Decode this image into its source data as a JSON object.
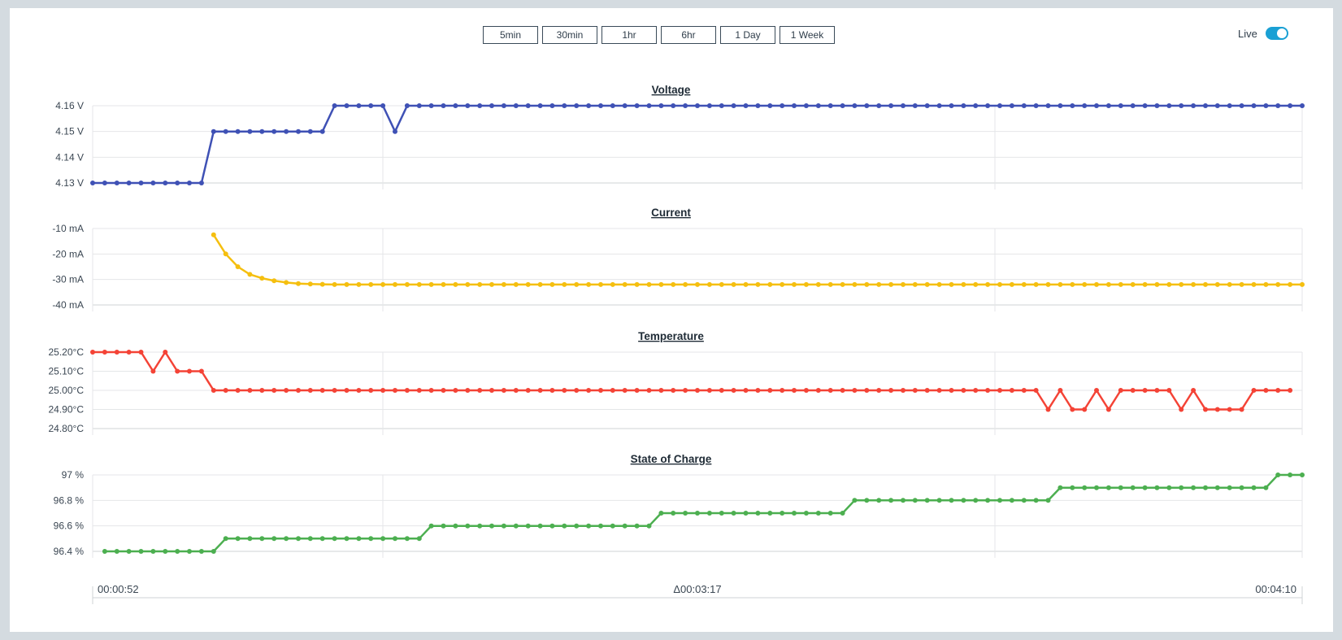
{
  "ranges": [
    "5min",
    "30min",
    "1hr",
    "6hr",
    "1 Day",
    "1 Week"
  ],
  "live": {
    "label": "Live",
    "on": true
  },
  "x_axis": {
    "start": "00:00:52",
    "delta": "Δ00:03:17",
    "end": "00:04:10"
  },
  "chart_data": [
    {
      "type": "line",
      "title": "Voltage",
      "color": "#3f51b5",
      "unit": "V",
      "yticks": [
        "4.16 V",
        "4.15 V",
        "4.14 V",
        "4.13 V"
      ],
      "ylim": [
        4.13,
        4.16
      ],
      "x_start_index": 0,
      "values": [
        4.13,
        4.13,
        4.13,
        4.13,
        4.13,
        4.13,
        4.13,
        4.13,
        4.13,
        4.13,
        4.15,
        4.15,
        4.15,
        4.15,
        4.15,
        4.15,
        4.15,
        4.15,
        4.15,
        4.15,
        4.16,
        4.16,
        4.16,
        4.16,
        4.16,
        4.15,
        4.16,
        4.16,
        4.16,
        4.16,
        4.16,
        4.16,
        4.16,
        4.16,
        4.16,
        4.16,
        4.16,
        4.16,
        4.16,
        4.16,
        4.16,
        4.16,
        4.16,
        4.16,
        4.16,
        4.16,
        4.16,
        4.16,
        4.16,
        4.16,
        4.16,
        4.16,
        4.16,
        4.16,
        4.16,
        4.16,
        4.16,
        4.16,
        4.16,
        4.16,
        4.16,
        4.16,
        4.16,
        4.16,
        4.16,
        4.16,
        4.16,
        4.16,
        4.16,
        4.16,
        4.16,
        4.16,
        4.16,
        4.16,
        4.16,
        4.16,
        4.16,
        4.16,
        4.16,
        4.16,
        4.16,
        4.16,
        4.16,
        4.16,
        4.16,
        4.16,
        4.16,
        4.16,
        4.16,
        4.16,
        4.16,
        4.16,
        4.16,
        4.16,
        4.16,
        4.16,
        4.16,
        4.16,
        4.16,
        4.16,
        4.16
      ]
    },
    {
      "type": "line",
      "title": "Current",
      "color": "#f5bf0f",
      "unit": "mA",
      "yticks": [
        "-10 mA",
        "-20 mA",
        "-30 mA",
        "-40 mA"
      ],
      "ylim": [
        -40,
        -10
      ],
      "x_start_index": 10,
      "values": [
        -12.5,
        -20,
        -25,
        -28,
        -29.5,
        -30.5,
        -31.2,
        -31.6,
        -31.8,
        -31.9,
        -32,
        -32,
        -32,
        -32,
        -32,
        -32,
        -32,
        -32,
        -32,
        -32,
        -32,
        -32,
        -32,
        -32,
        -32,
        -32,
        -32,
        -32,
        -32,
        -32,
        -32,
        -32,
        -32,
        -32,
        -32,
        -32,
        -32,
        -32,
        -32,
        -32,
        -32,
        -32,
        -32,
        -32,
        -32,
        -32,
        -32,
        -32,
        -32,
        -32,
        -32,
        -32,
        -32,
        -32,
        -32,
        -32,
        -32,
        -32,
        -32,
        -32,
        -32,
        -32,
        -32,
        -32,
        -32,
        -32,
        -32,
        -32,
        -32,
        -32,
        -32,
        -32,
        -32,
        -32,
        -32,
        -32,
        -32,
        -32,
        -32,
        -32,
        -32,
        -32,
        -32,
        -32,
        -32,
        -32,
        -32,
        -32,
        -32,
        -32,
        -32
      ]
    },
    {
      "type": "line",
      "title": "Temperature",
      "color": "#f44336",
      "unit": "°C",
      "yticks": [
        "25.20°C",
        "25.10°C",
        "25.00°C",
        "24.90°C",
        "24.80°C"
      ],
      "ylim": [
        24.8,
        25.2
      ],
      "x_start_index": 0,
      "values": [
        25.2,
        25.2,
        25.2,
        25.2,
        25.2,
        25.1,
        25.2,
        25.1,
        25.1,
        25.1,
        25.0,
        25.0,
        25.0,
        25.0,
        25.0,
        25.0,
        25.0,
        25.0,
        25.0,
        25.0,
        25.0,
        25.0,
        25.0,
        25.0,
        25.0,
        25.0,
        25.0,
        25.0,
        25.0,
        25.0,
        25.0,
        25.0,
        25.0,
        25.0,
        25.0,
        25.0,
        25.0,
        25.0,
        25.0,
        25.0,
        25.0,
        25.0,
        25.0,
        25.0,
        25.0,
        25.0,
        25.0,
        25.0,
        25.0,
        25.0,
        25.0,
        25.0,
        25.0,
        25.0,
        25.0,
        25.0,
        25.0,
        25.0,
        25.0,
        25.0,
        25.0,
        25.0,
        25.0,
        25.0,
        25.0,
        25.0,
        25.0,
        25.0,
        25.0,
        25.0,
        25.0,
        25.0,
        25.0,
        25.0,
        25.0,
        25.0,
        25.0,
        25.0,
        25.0,
        24.9,
        25.0,
        24.9,
        24.9,
        25.0,
        24.9,
        25.0,
        25.0,
        25.0,
        25.0,
        25.0,
        24.9,
        25.0,
        24.9,
        24.9,
        24.9,
        24.9,
        25.0,
        25.0,
        25.0,
        25.0
      ]
    },
    {
      "type": "line",
      "title": "State of Charge",
      "color": "#4caf50",
      "unit": "%",
      "yticks": [
        "97 %",
        "96.8 %",
        "96.6 %",
        "96.4 %"
      ],
      "ylim": [
        96.4,
        97.0
      ],
      "x_start_index": 1,
      "values": [
        96.4,
        96.4,
        96.4,
        96.4,
        96.4,
        96.4,
        96.4,
        96.4,
        96.4,
        96.4,
        96.5,
        96.5,
        96.5,
        96.5,
        96.5,
        96.5,
        96.5,
        96.5,
        96.5,
        96.5,
        96.5,
        96.5,
        96.5,
        96.5,
        96.5,
        96.5,
        96.5,
        96.6,
        96.6,
        96.6,
        96.6,
        96.6,
        96.6,
        96.6,
        96.6,
        96.6,
        96.6,
        96.6,
        96.6,
        96.6,
        96.6,
        96.6,
        96.6,
        96.6,
        96.6,
        96.6,
        96.7,
        96.7,
        96.7,
        96.7,
        96.7,
        96.7,
        96.7,
        96.7,
        96.7,
        96.7,
        96.7,
        96.7,
        96.7,
        96.7,
        96.7,
        96.7,
        96.8,
        96.8,
        96.8,
        96.8,
        96.8,
        96.8,
        96.8,
        96.8,
        96.8,
        96.8,
        96.8,
        96.8,
        96.8,
        96.8,
        96.8,
        96.8,
        96.8,
        96.9,
        96.9,
        96.9,
        96.9,
        96.9,
        96.9,
        96.9,
        96.9,
        96.9,
        96.9,
        96.9,
        96.9,
        96.9,
        96.9,
        96.9,
        96.9,
        96.9,
        96.9,
        97.0,
        97.0,
        97.0
      ]
    }
  ]
}
